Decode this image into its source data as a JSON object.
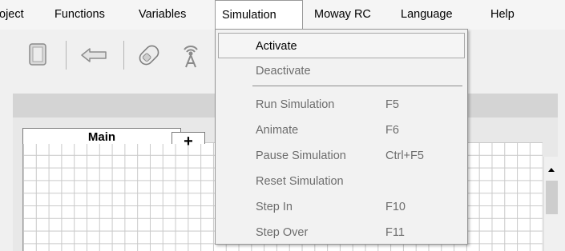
{
  "menubar": {
    "items": [
      {
        "label": "oject",
        "name": "menu-project"
      },
      {
        "label": "Functions",
        "name": "menu-functions"
      },
      {
        "label": "Variables",
        "name": "menu-variables"
      },
      {
        "label": "Simulation",
        "name": "menu-simulation"
      },
      {
        "label": "Moway RC",
        "name": "menu-moway-rc"
      },
      {
        "label": "Language",
        "name": "menu-language"
      },
      {
        "label": "Help",
        "name": "menu-help"
      }
    ]
  },
  "toolbar": {
    "icons": [
      "document-icon",
      "arrow-left-icon",
      "moway-robot-icon",
      "radio-antenna-icon"
    ]
  },
  "canvas": {
    "tabs": [
      "Main",
      "+"
    ]
  },
  "dropdown": {
    "items": [
      {
        "label": "Activate",
        "shortcut": "",
        "enabled": true,
        "highlighted": true
      },
      {
        "label": "Deactivate",
        "shortcut": "",
        "enabled": false
      },
      {
        "label": "Run Simulation",
        "shortcut": "F5",
        "enabled": false
      },
      {
        "label": "Animate",
        "shortcut": "F6",
        "enabled": false
      },
      {
        "label": "Pause Simulation",
        "shortcut": "Ctrl+F5",
        "enabled": false
      },
      {
        "label": "Reset Simulation",
        "shortcut": "",
        "enabled": false
      },
      {
        "label": "Step In",
        "shortcut": "F10",
        "enabled": false
      },
      {
        "label": "Step Over",
        "shortcut": "F11",
        "enabled": false
      }
    ]
  },
  "colors": {
    "menubar_bg": "#f5f5f5",
    "grid_line": "#c9c9c9",
    "disabled_text": "#6d6d6d"
  }
}
